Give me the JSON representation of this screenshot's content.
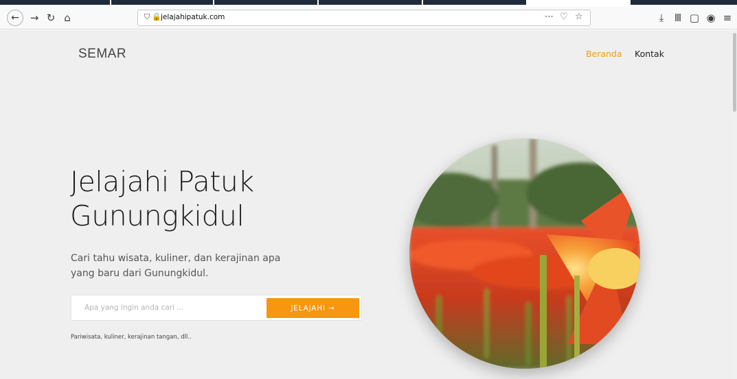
{
  "browser": {
    "url": "jelajahipatuk.com",
    "back_icon": "back-arrow-icon",
    "forward_icon": "forward-arrow-icon",
    "reload_icon": "reload-icon",
    "home_icon": "home-icon"
  },
  "site": {
    "brand": "SEMAR",
    "nav": [
      {
        "label": "Beranda",
        "color": "#f39c12",
        "active": true
      },
      {
        "label": "Kontak",
        "color": "#222222",
        "active": false
      }
    ]
  },
  "hero": {
    "title_line1": "Jelajahi Patuk",
    "title_line2": "Gunungkidul",
    "subtitle_line1": "Cari tahu wisata, kuliner, dan kerajinan apa",
    "subtitle_line2": "yang baru dari Gunungkidul.",
    "search_placeholder": "Apa yang ingin anda cari ...",
    "search_button": "JELAJAHI →",
    "hint": "Pariwisata, kuliner, kerajinan tangan, dll..",
    "accent_color": "#f7960f"
  }
}
